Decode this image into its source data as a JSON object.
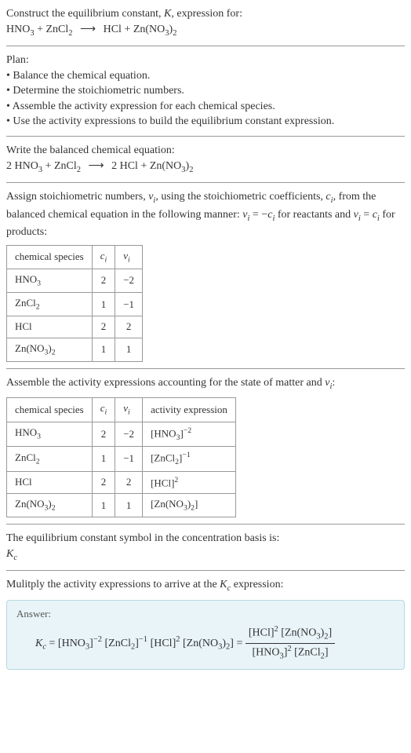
{
  "prompt": {
    "line1_text": "Construct the equilibrium constant, ",
    "line1_k": "K",
    "line1_after": ", expression for:",
    "equation_lhs1": "HNO",
    "equation_lhs1_sub": "3",
    "equation_plus": " + ZnCl",
    "equation_lhs2_sub": "2",
    "arrow": "⟶",
    "equation_rhs": "HCl + Zn(NO",
    "equation_rhs_sub1": "3",
    "equation_rhs_close": ")",
    "equation_rhs_sub2": "2"
  },
  "plan": {
    "heading": "Plan:",
    "b1": "• Balance the chemical equation.",
    "b2": "• Determine the stoichiometric numbers.",
    "b3": "• Assemble the activity expression for each chemical species.",
    "b4": "• Use the activity expressions to build the equilibrium constant expression."
  },
  "balanced": {
    "heading": "Write the balanced chemical equation:",
    "eq_lhs": "2 HNO",
    "eq_lhs_sub": "3",
    "eq_plus": " + ZnCl",
    "eq_plus_sub": "2",
    "arrow": "⟶",
    "eq_rhs": "2 HCl + Zn(NO",
    "eq_rhs_sub1": "3",
    "eq_rhs_close": ")",
    "eq_rhs_sub2": "2"
  },
  "assign": {
    "text1": "Assign stoichiometric numbers, ",
    "nu": "ν",
    "nu_sub": "i",
    "text2": ", using the stoichiometric coefficients, ",
    "c": "c",
    "c_sub": "i",
    "text3": ", from the balanced chemical equation in the following manner: ",
    "eq1_lhs": "ν",
    "eq1_lhs_sub": "i",
    "eq1_eq": " = −",
    "eq1_rhs": "c",
    "eq1_rhs_sub": "i",
    "text4": " for reactants and ",
    "eq2_lhs": "ν",
    "eq2_lhs_sub": "i",
    "eq2_eq": " = ",
    "eq2_rhs": "c",
    "eq2_rhs_sub": "i",
    "text5": " for products:"
  },
  "table1": {
    "h1": "chemical species",
    "h2_sym": "c",
    "h2_sub": "i",
    "h3_sym": "ν",
    "h3_sub": "i",
    "rows": [
      {
        "sp": "HNO",
        "sp_sub": "3",
        "c": "2",
        "nu": "−2"
      },
      {
        "sp": "ZnCl",
        "sp_sub": "2",
        "c": "1",
        "nu": "−1"
      },
      {
        "sp": "HCl",
        "sp_sub": "",
        "c": "2",
        "nu": "2"
      },
      {
        "sp": "Zn(NO",
        "sp_sub": "3",
        "sp_close": ")",
        "sp_sub2": "2",
        "c": "1",
        "nu": "1"
      }
    ]
  },
  "assemble": {
    "text1": "Assemble the activity expressions accounting for the state of matter and ",
    "nu": "ν",
    "nu_sub": "i",
    "text2": ":"
  },
  "table2": {
    "h1": "chemical species",
    "h2_sym": "c",
    "h2_sub": "i",
    "h3_sym": "ν",
    "h3_sub": "i",
    "h4": "activity expression",
    "rows": [
      {
        "sp": "HNO",
        "sp_sub": "3",
        "c": "2",
        "nu": "−2",
        "act_base": "[HNO",
        "act_sub": "3",
        "act_close": "]",
        "act_exp": "−2"
      },
      {
        "sp": "ZnCl",
        "sp_sub": "2",
        "c": "1",
        "nu": "−1",
        "act_base": "[ZnCl",
        "act_sub": "2",
        "act_close": "]",
        "act_exp": "−1"
      },
      {
        "sp": "HCl",
        "sp_sub": "",
        "c": "2",
        "nu": "2",
        "act_base": "[HCl]",
        "act_sub": "",
        "act_close": "",
        "act_exp": "2"
      },
      {
        "sp": "Zn(NO",
        "sp_sub": "3",
        "sp_close": ")",
        "sp_sub2": "2",
        "c": "1",
        "nu": "1",
        "act_base": "[Zn(NO",
        "act_sub": "3",
        "act_close": ")",
        "act_sub2": "2",
        "act_close2": "]",
        "act_exp": ""
      }
    ]
  },
  "kc_symbol": {
    "text": "The equilibrium constant symbol in the concentration basis is:",
    "k": "K",
    "k_sub": "c"
  },
  "multiply": {
    "text1": "Mulitply the activity expressions to arrive at the ",
    "k": "K",
    "k_sub": "c",
    "text2": " expression:"
  },
  "answer": {
    "label": "Answer:",
    "k": "K",
    "k_sub": "c",
    "eq": " = ",
    "t1": "[HNO",
    "t1_sub": "3",
    "t1_close": "]",
    "t1_exp": "−2",
    "sp": " ",
    "t2": "[ZnCl",
    "t2_sub": "2",
    "t2_close": "]",
    "t2_exp": "−1",
    "t3": "[HCl]",
    "t3_exp": "2",
    "t4": "[Zn(NO",
    "t4_sub": "3",
    "t4_close": ")",
    "t4_sub2": "2",
    "t4_close2": "]",
    "eq2": " = ",
    "num1": "[HCl]",
    "num1_exp": "2",
    "num2": "[Zn(NO",
    "num2_sub": "3",
    "num2_close": ")",
    "num2_sub2": "2",
    "num2_close2": "]",
    "den1": "[HNO",
    "den1_sub": "3",
    "den1_close": "]",
    "den1_exp": "2",
    "den2": "[ZnCl",
    "den2_sub": "2",
    "den2_close": "]"
  }
}
